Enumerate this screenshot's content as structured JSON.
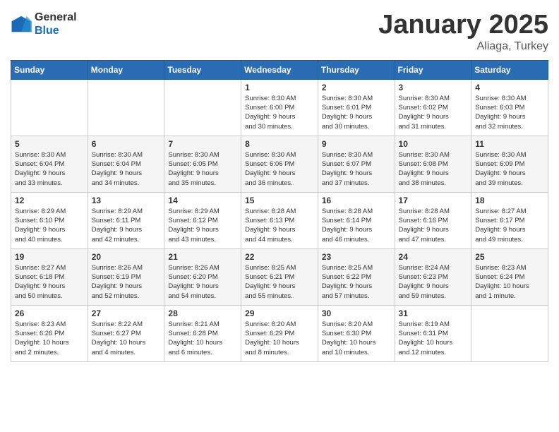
{
  "logo": {
    "general": "General",
    "blue": "Blue"
  },
  "header": {
    "month_year": "January 2025",
    "location": "Aliaga, Turkey"
  },
  "weekdays": [
    "Sunday",
    "Monday",
    "Tuesday",
    "Wednesday",
    "Thursday",
    "Friday",
    "Saturday"
  ],
  "weeks": [
    [
      {
        "day": "",
        "info": ""
      },
      {
        "day": "",
        "info": ""
      },
      {
        "day": "",
        "info": ""
      },
      {
        "day": "1",
        "info": "Sunrise: 8:30 AM\nSunset: 6:00 PM\nDaylight: 9 hours\nand 30 minutes."
      },
      {
        "day": "2",
        "info": "Sunrise: 8:30 AM\nSunset: 6:01 PM\nDaylight: 9 hours\nand 30 minutes."
      },
      {
        "day": "3",
        "info": "Sunrise: 8:30 AM\nSunset: 6:02 PM\nDaylight: 9 hours\nand 31 minutes."
      },
      {
        "day": "4",
        "info": "Sunrise: 8:30 AM\nSunset: 6:03 PM\nDaylight: 9 hours\nand 32 minutes."
      }
    ],
    [
      {
        "day": "5",
        "info": "Sunrise: 8:30 AM\nSunset: 6:04 PM\nDaylight: 9 hours\nand 33 minutes."
      },
      {
        "day": "6",
        "info": "Sunrise: 8:30 AM\nSunset: 6:04 PM\nDaylight: 9 hours\nand 34 minutes."
      },
      {
        "day": "7",
        "info": "Sunrise: 8:30 AM\nSunset: 6:05 PM\nDaylight: 9 hours\nand 35 minutes."
      },
      {
        "day": "8",
        "info": "Sunrise: 8:30 AM\nSunset: 6:06 PM\nDaylight: 9 hours\nand 36 minutes."
      },
      {
        "day": "9",
        "info": "Sunrise: 8:30 AM\nSunset: 6:07 PM\nDaylight: 9 hours\nand 37 minutes."
      },
      {
        "day": "10",
        "info": "Sunrise: 8:30 AM\nSunset: 6:08 PM\nDaylight: 9 hours\nand 38 minutes."
      },
      {
        "day": "11",
        "info": "Sunrise: 8:30 AM\nSunset: 6:09 PM\nDaylight: 9 hours\nand 39 minutes."
      }
    ],
    [
      {
        "day": "12",
        "info": "Sunrise: 8:29 AM\nSunset: 6:10 PM\nDaylight: 9 hours\nand 40 minutes."
      },
      {
        "day": "13",
        "info": "Sunrise: 8:29 AM\nSunset: 6:11 PM\nDaylight: 9 hours\nand 42 minutes."
      },
      {
        "day": "14",
        "info": "Sunrise: 8:29 AM\nSunset: 6:12 PM\nDaylight: 9 hours\nand 43 minutes."
      },
      {
        "day": "15",
        "info": "Sunrise: 8:28 AM\nSunset: 6:13 PM\nDaylight: 9 hours\nand 44 minutes."
      },
      {
        "day": "16",
        "info": "Sunrise: 8:28 AM\nSunset: 6:14 PM\nDaylight: 9 hours\nand 46 minutes."
      },
      {
        "day": "17",
        "info": "Sunrise: 8:28 AM\nSunset: 6:16 PM\nDaylight: 9 hours\nand 47 minutes."
      },
      {
        "day": "18",
        "info": "Sunrise: 8:27 AM\nSunset: 6:17 PM\nDaylight: 9 hours\nand 49 minutes."
      }
    ],
    [
      {
        "day": "19",
        "info": "Sunrise: 8:27 AM\nSunset: 6:18 PM\nDaylight: 9 hours\nand 50 minutes."
      },
      {
        "day": "20",
        "info": "Sunrise: 8:26 AM\nSunset: 6:19 PM\nDaylight: 9 hours\nand 52 minutes."
      },
      {
        "day": "21",
        "info": "Sunrise: 8:26 AM\nSunset: 6:20 PM\nDaylight: 9 hours\nand 54 minutes."
      },
      {
        "day": "22",
        "info": "Sunrise: 8:25 AM\nSunset: 6:21 PM\nDaylight: 9 hours\nand 55 minutes."
      },
      {
        "day": "23",
        "info": "Sunrise: 8:25 AM\nSunset: 6:22 PM\nDaylight: 9 hours\nand 57 minutes."
      },
      {
        "day": "24",
        "info": "Sunrise: 8:24 AM\nSunset: 6:23 PM\nDaylight: 9 hours\nand 59 minutes."
      },
      {
        "day": "25",
        "info": "Sunrise: 8:23 AM\nSunset: 6:24 PM\nDaylight: 10 hours\nand 1 minute."
      }
    ],
    [
      {
        "day": "26",
        "info": "Sunrise: 8:23 AM\nSunset: 6:26 PM\nDaylight: 10 hours\nand 2 minutes."
      },
      {
        "day": "27",
        "info": "Sunrise: 8:22 AM\nSunset: 6:27 PM\nDaylight: 10 hours\nand 4 minutes."
      },
      {
        "day": "28",
        "info": "Sunrise: 8:21 AM\nSunset: 6:28 PM\nDaylight: 10 hours\nand 6 minutes."
      },
      {
        "day": "29",
        "info": "Sunrise: 8:20 AM\nSunset: 6:29 PM\nDaylight: 10 hours\nand 8 minutes."
      },
      {
        "day": "30",
        "info": "Sunrise: 8:20 AM\nSunset: 6:30 PM\nDaylight: 10 hours\nand 10 minutes."
      },
      {
        "day": "31",
        "info": "Sunrise: 8:19 AM\nSunset: 6:31 PM\nDaylight: 10 hours\nand 12 minutes."
      },
      {
        "day": "",
        "info": ""
      }
    ]
  ]
}
